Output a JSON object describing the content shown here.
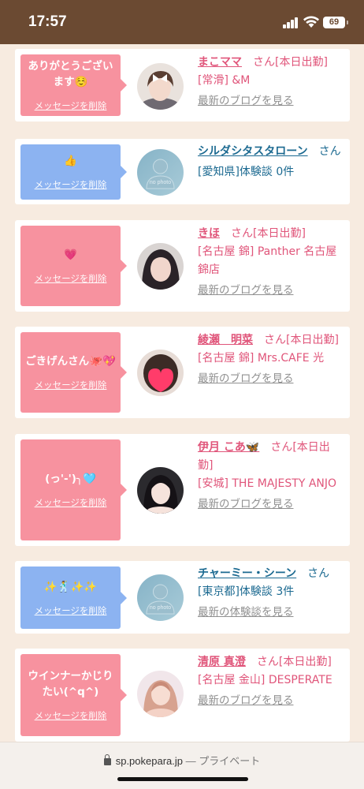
{
  "status_bar": {
    "time": "17:57",
    "battery": "69"
  },
  "browser": {
    "url": "sp.pokepara.jp",
    "separator": "—",
    "mode": "プライベート"
  },
  "cards": [
    {
      "bubble_color": "pink",
      "message": "ありがとうございます☺️",
      "delete_label": "メッセージを削除",
      "name": "まこママ",
      "name_color": "pink",
      "honorific": "さん",
      "status": "[本日出勤]",
      "shop": "[常滑] &M",
      "link": "最新のブログを見る",
      "avatar": "photo-icon"
    },
    {
      "bubble_color": "blue",
      "message": "👍",
      "delete_label": "メッセージを削除",
      "name": "シルダシタスタローン",
      "name_color": "blue",
      "honorific": "さん",
      "status": "",
      "shop": "[愛知県]体験談 0件",
      "link": "",
      "avatar": "no-photo-icon",
      "avatar_text": "no photo"
    },
    {
      "bubble_color": "pink",
      "message": "💗",
      "delete_label": "メッセージを削除",
      "name": "きほ",
      "name_color": "pink",
      "honorific": "さん",
      "status": "[本日出勤]",
      "shop": "[名古屋 錦] Panther 名古屋錦店",
      "link": "最新のブログを見る",
      "avatar": "photo-icon"
    },
    {
      "bubble_color": "pink",
      "message": "ごきげんさん🐙💖",
      "delete_label": "メッセージを削除",
      "name": "綾瀬　明菜",
      "name_color": "pink",
      "honorific": "さん",
      "status": "[本日出勤]",
      "shop": "[名古屋 錦] Mrs.CAFE 光",
      "link": "最新のブログを見る",
      "avatar": "photo-icon"
    },
    {
      "bubble_color": "pink",
      "message": "(っ'-')╮🩵",
      "delete_label": "メッセージを削除",
      "name": "伊月 こあ🦋",
      "name_color": "pink",
      "honorific": "さん",
      "status": "[本日出勤]",
      "shop": "[安城] THE MAJESTY ANJO",
      "link": "最新のブログを見る",
      "avatar": "photo-icon"
    },
    {
      "bubble_color": "blue",
      "message": "✨🕺✨✨",
      "delete_label": "メッセージを削除",
      "name": "チャーミー・シーン",
      "name_color": "blue",
      "honorific": "さん",
      "status": "",
      "shop": "[東京都]体験談 3件",
      "link": "最新の体験談を見る",
      "avatar": "no-photo-icon",
      "avatar_text": "no photo"
    },
    {
      "bubble_color": "pink",
      "message": "ウインナーかじりたい(^q^)",
      "delete_label": "メッセージを削除",
      "name": "清原 真澄",
      "name_color": "pink",
      "honorific": "さん",
      "status": "[本日出勤]",
      "shop": "[名古屋 金山] DESPERATE",
      "link": "最新のブログを見る",
      "avatar": "photo-icon"
    }
  ]
}
